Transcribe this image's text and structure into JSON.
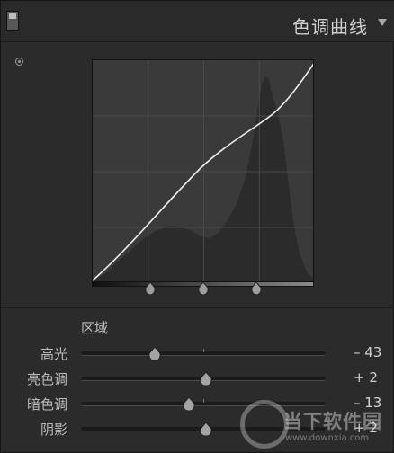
{
  "panel": {
    "title": "色调曲线"
  },
  "region": {
    "label": "区域",
    "sliders": [
      {
        "label": "高光",
        "value": "– 43",
        "level": -0.43
      },
      {
        "label": "亮色调",
        "value": "+ 2",
        "level": 0.02
      },
      {
        "label": "暗色调",
        "value": "– 13",
        "level": -0.13
      },
      {
        "label": "阴影",
        "value": "+ 2",
        "level": 0.02
      }
    ]
  },
  "split_points": [
    0.25,
    0.5,
    0.75
  ],
  "watermark": {
    "brand": "当下软件园",
    "url": "www.downxia.com"
  },
  "icons": [
    "collapse-toggle-icon",
    "target-adjust-icon",
    "collapse-triangle-icon",
    "split-handle-icon",
    "slider-thumb-icon",
    "watermark-logo-icon"
  ]
}
